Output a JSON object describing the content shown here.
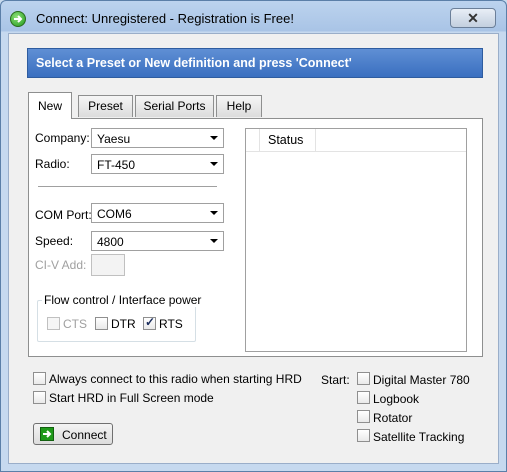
{
  "window": {
    "title": "Connect: Unregistered - Registration is Free!",
    "close_symbol": "✕"
  },
  "banner": "Select a Preset or New definition and press 'Connect'",
  "tabs": [
    {
      "label": "New",
      "active": true
    },
    {
      "label": "Preset",
      "active": false
    },
    {
      "label": "Serial Ports",
      "active": false
    },
    {
      "label": "Help",
      "active": false
    }
  ],
  "form": {
    "company_label": "Company:",
    "company_value": "Yaesu",
    "radio_label": "Radio:",
    "radio_value": "FT-450",
    "com_label": "COM Port:",
    "com_value": "COM6",
    "speed_label": "Speed:",
    "speed_value": "4800",
    "civ_label": "CI-V Add:"
  },
  "flow": {
    "title": "Flow control / Interface power",
    "cts": {
      "label": "CTS",
      "checked": false,
      "disabled": true
    },
    "dtr": {
      "label": "DTR",
      "checked": false
    },
    "rts": {
      "label": "RTS",
      "checked": true
    }
  },
  "status": {
    "header": "Status"
  },
  "options": {
    "always_connect": "Always connect to this radio when starting HRD",
    "full_screen": "Start HRD in Full Screen mode"
  },
  "start": {
    "label": "Start:",
    "items": [
      "Digital Master 780",
      "Logbook",
      "Rotator",
      "Satellite Tracking"
    ]
  },
  "connect_button": "Connect",
  "colors": {
    "banner": "#4a7ecb",
    "accent_green": "#1f9a1a"
  }
}
